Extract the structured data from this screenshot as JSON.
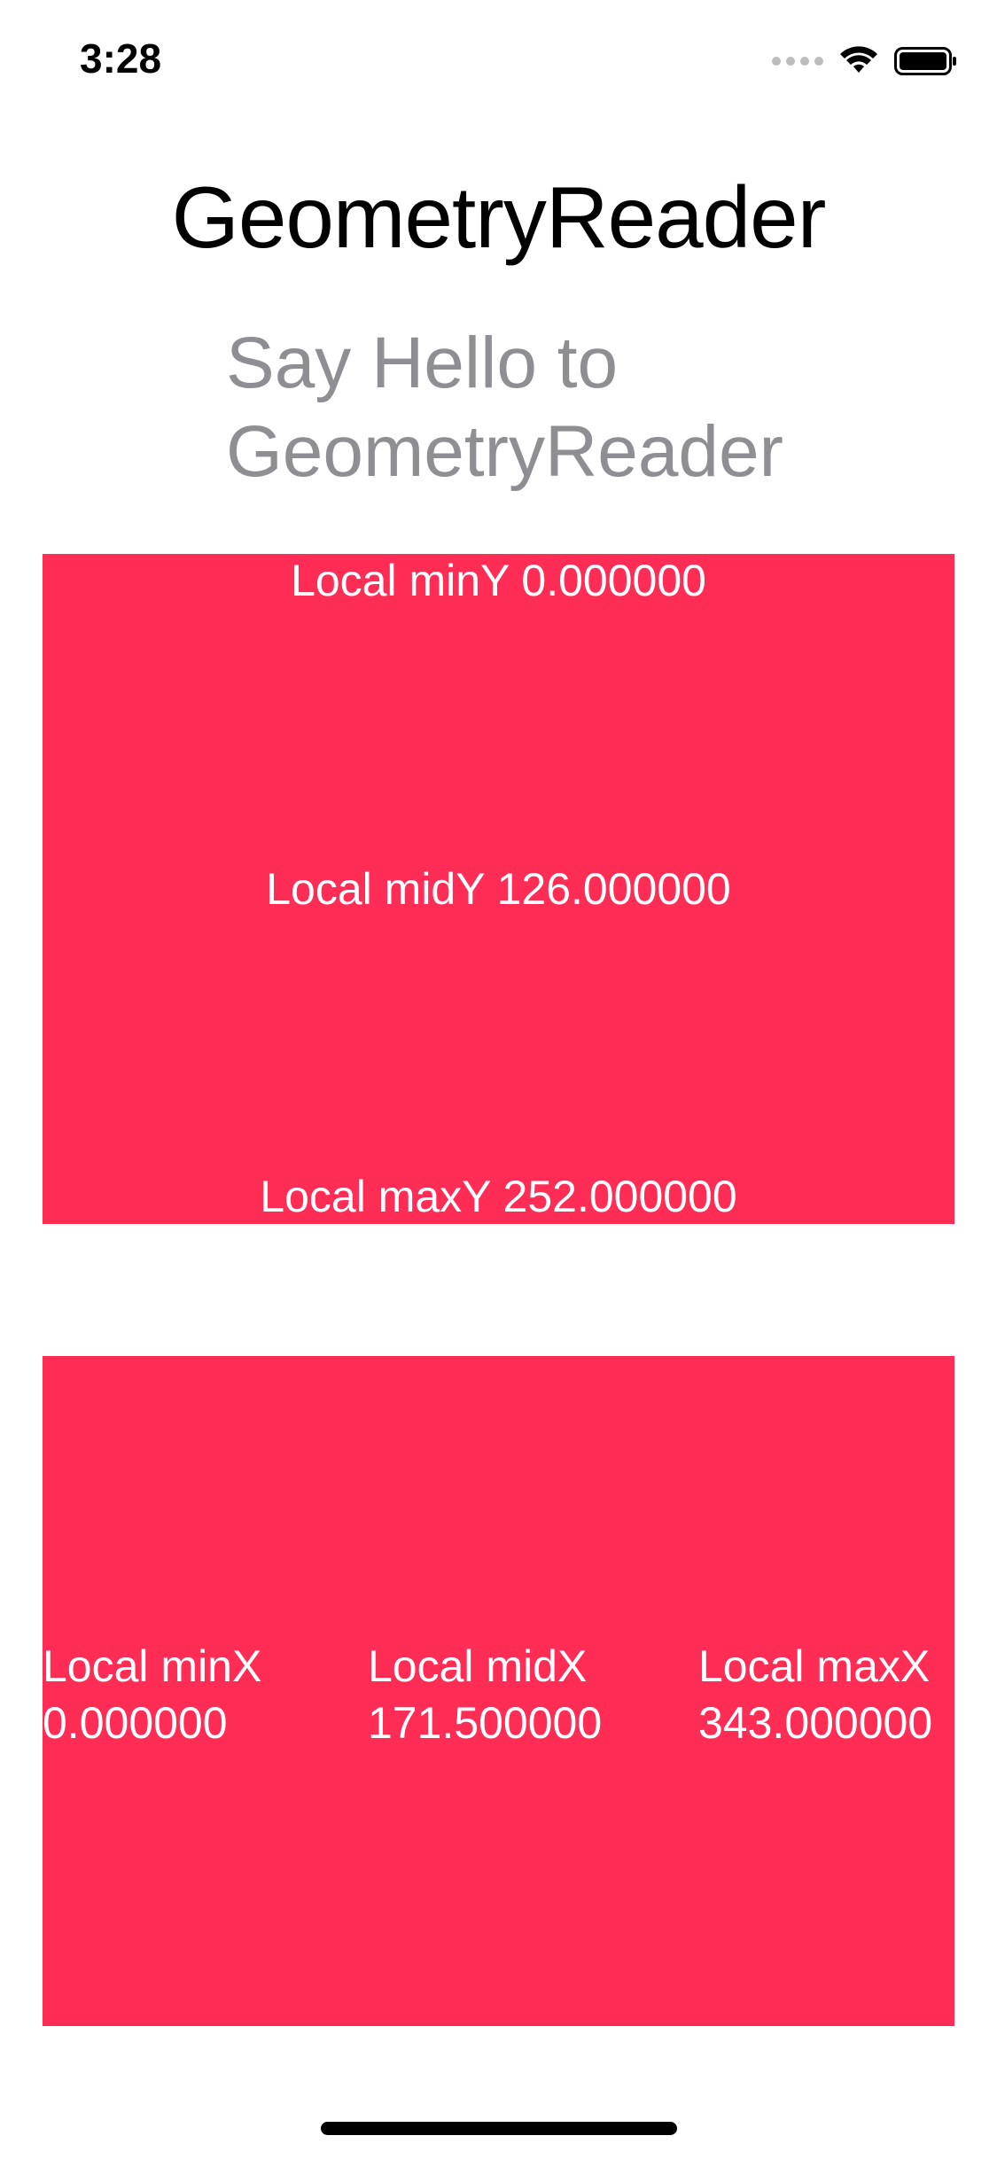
{
  "status_bar": {
    "time": "3:28",
    "icons": [
      "signal-dots-icon",
      "wifi-icon",
      "battery-icon"
    ]
  },
  "title": "GeometryReader",
  "subtitle": "Say Hello to GeometryReader",
  "y_panel": {
    "min_label": "Local minY 0.000000",
    "mid_label": "Local midY 126.000000",
    "max_label": "Local maxY 252.000000"
  },
  "x_panel": {
    "min_title": "Local minX",
    "min_value": "0.000000",
    "mid_title": "Local midX",
    "mid_value": "171.500000",
    "max_title": "Local maxX",
    "max_value": "343.000000"
  },
  "colors": {
    "panel": "#ff2d55",
    "subtitle": "#8e8e93"
  }
}
